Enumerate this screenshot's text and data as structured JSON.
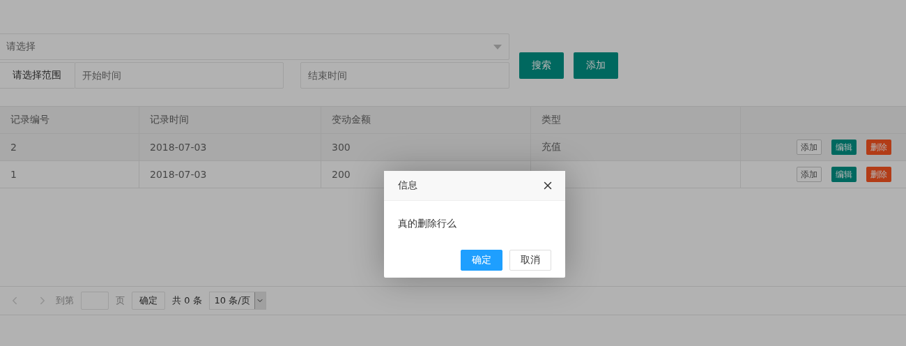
{
  "filter": {
    "select": {
      "placeholder": "请选择"
    },
    "range_label": "请选择范围",
    "start": {
      "placeholder": "开始时间"
    },
    "end": {
      "placeholder": "结束时间"
    },
    "buttons": [
      "搜索",
      "添加"
    ]
  },
  "table": {
    "columns": [
      "记录编号",
      "记录时间",
      "变动金额",
      "类型"
    ],
    "rows": [
      {
        "cells": [
          "2",
          "2018-07-03",
          "300",
          "充值"
        ],
        "actions": [
          {
            "label": "添加",
            "kind": "plain"
          },
          {
            "label": "编辑",
            "kind": "edit"
          },
          {
            "label": "删除",
            "kind": "danger"
          }
        ]
      },
      {
        "cells": [
          "1",
          "2018-07-03",
          "200"
        ],
        "actions": [
          {
            "label": "添加",
            "kind": "plain"
          },
          {
            "label": "编辑",
            "kind": "edit"
          },
          {
            "label": "删除",
            "kind": "danger"
          }
        ]
      }
    ]
  },
  "pagination": {
    "goto_label": "到第",
    "page_unit": "页",
    "confirm": "确定",
    "total": "共 0 条",
    "page_size": "10 条/页"
  },
  "dialog": {
    "title": "信息",
    "message": "真的删除行么",
    "buttons": [
      {
        "label": "确定",
        "kind": "primary"
      },
      {
        "label": "取消",
        "kind": "default"
      }
    ]
  }
}
